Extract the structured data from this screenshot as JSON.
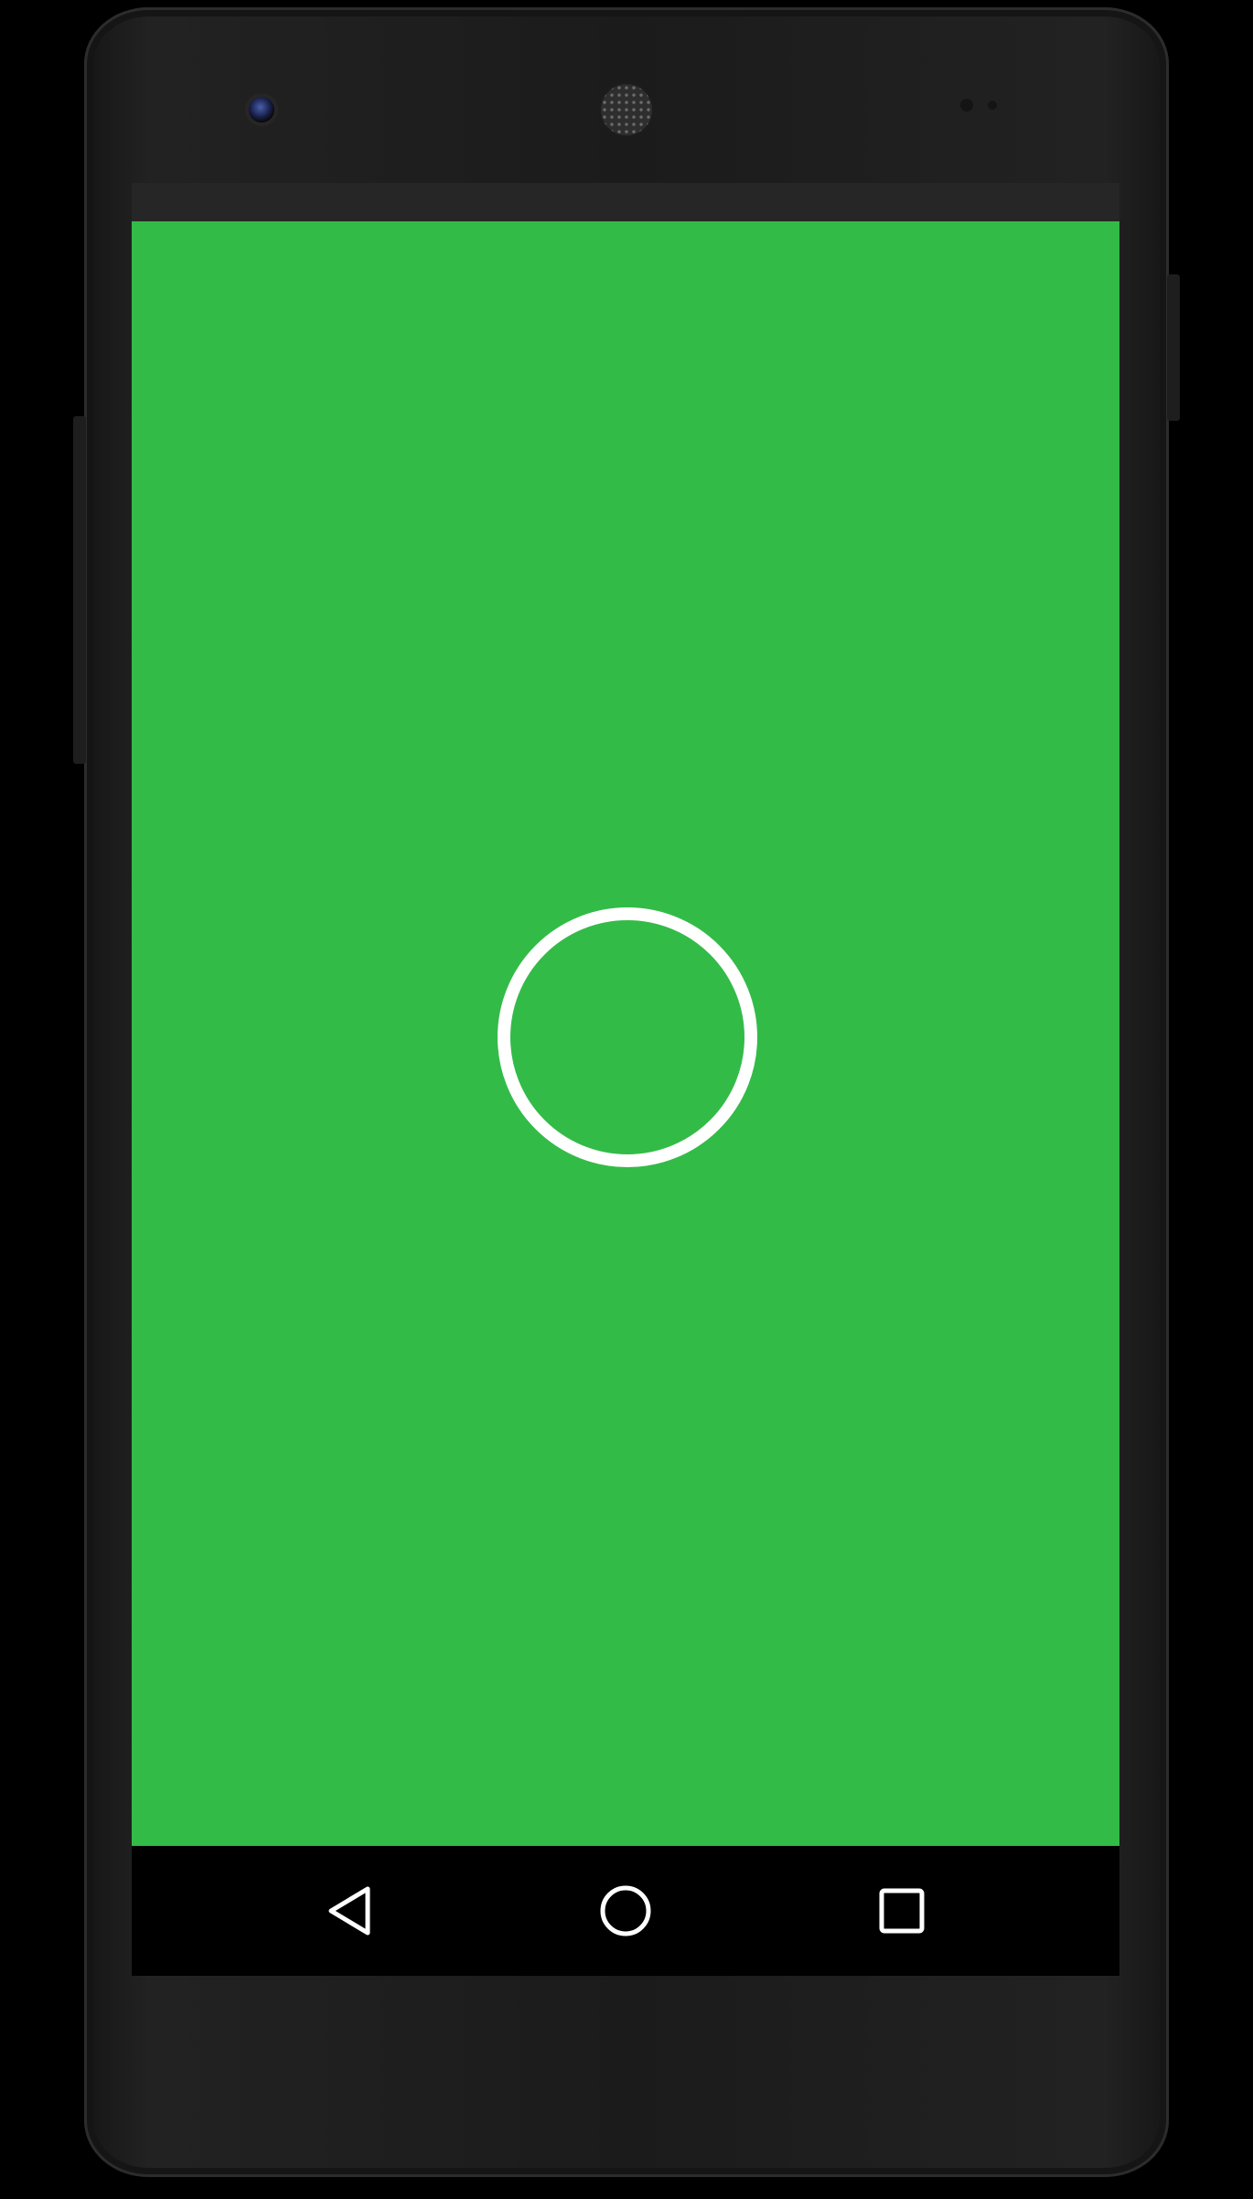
{
  "device": {
    "model_style": "android-phone"
  },
  "theme": {
    "app_background": "#33bb48",
    "ring_color": "#ffffff",
    "status_bar_color": "#262626",
    "nav_bar_color": "#000000",
    "nav_icon_color": "#ffffff"
  },
  "screen": {
    "content": {
      "indicator": "loading-ring-icon"
    },
    "navigation": {
      "buttons": [
        {
          "id": "back",
          "icon": "back-triangle-icon"
        },
        {
          "id": "home",
          "icon": "home-circle-icon"
        },
        {
          "id": "recents",
          "icon": "recents-square-icon"
        }
      ]
    }
  }
}
